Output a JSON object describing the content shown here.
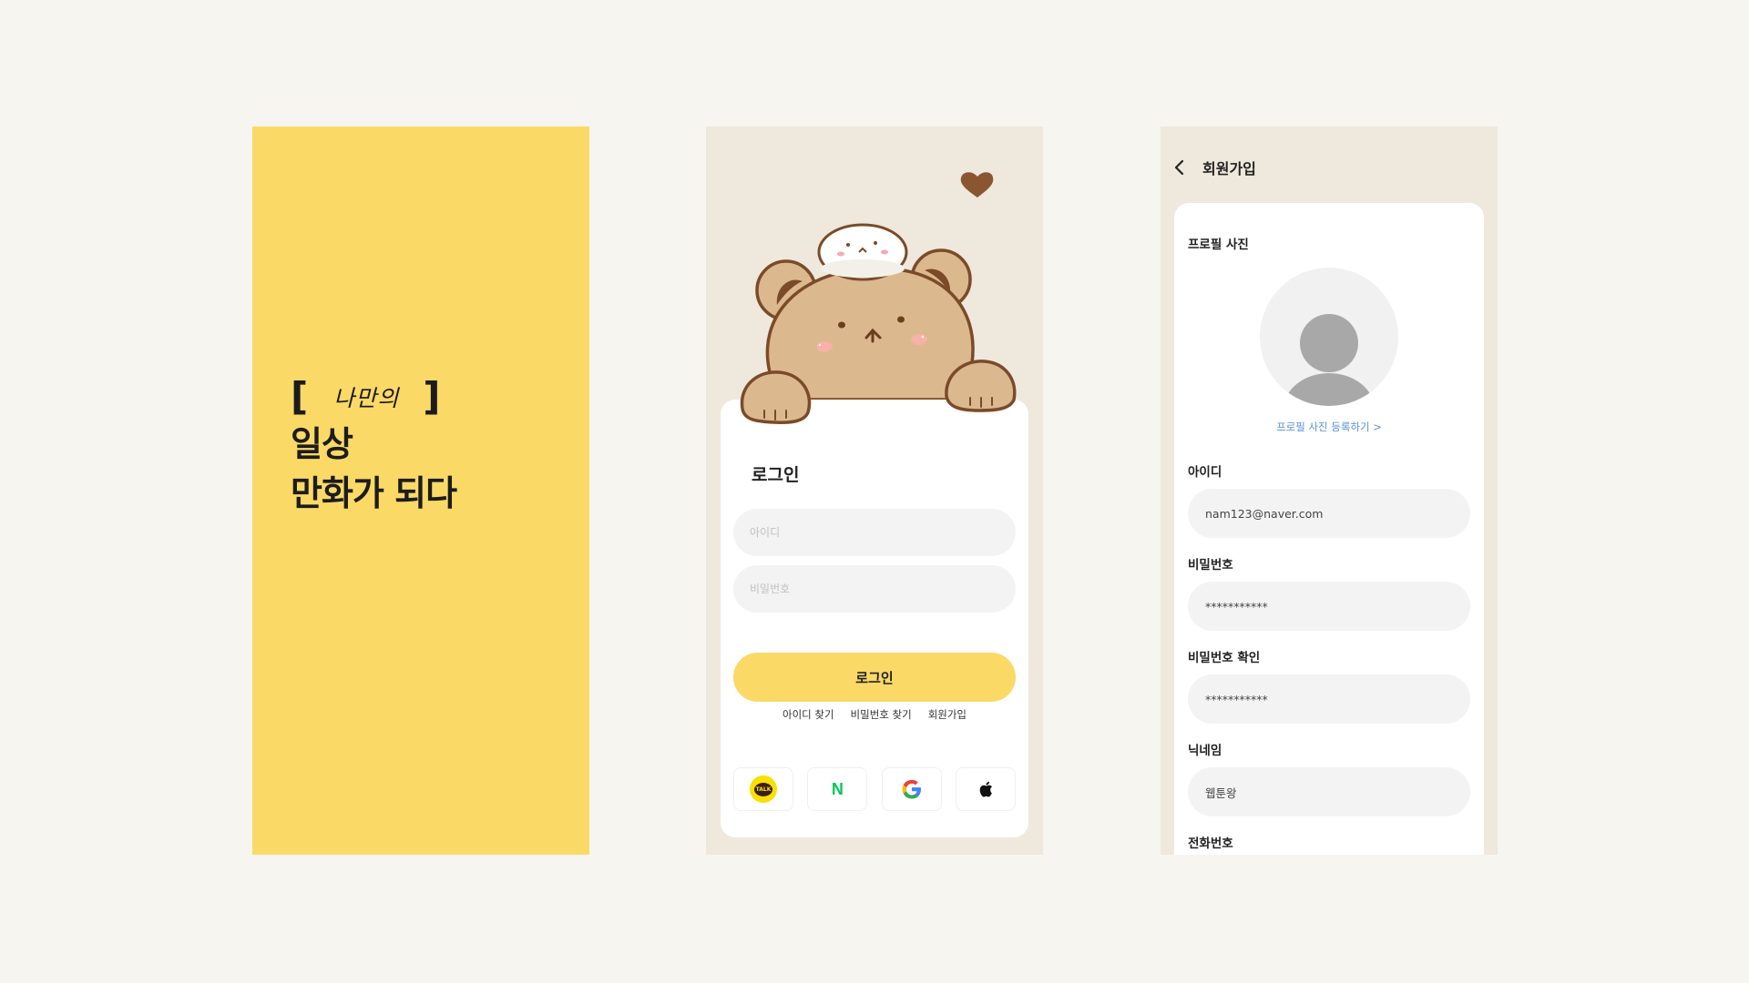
{
  "splash": {
    "bracket_open": "[",
    "script_word": "나만의",
    "bracket_close": "]",
    "line1": "일상",
    "line2": "만화가 되다"
  },
  "login": {
    "title": "로그인",
    "id_placeholder": "아이디",
    "pw_placeholder": "비밀번호",
    "login_button": "로그인",
    "links": [
      "아이디 찾기",
      "비밀번호 찾기",
      "회원가입"
    ],
    "social": [
      {
        "icon": "kakao-talk-icon",
        "text": "TALK"
      },
      {
        "icon": "naver-icon",
        "text": "N"
      },
      {
        "icon": "google-icon",
        "text": "G"
      },
      {
        "icon": "apple-icon",
        "text": ""
      }
    ]
  },
  "signup": {
    "title": "회원가입",
    "profile_label": "프로필 사진",
    "photo_link": "프로필 사진 등록하기 >",
    "id_label": "아이디",
    "id_value": "nam123@naver.com",
    "pw_label": "비밀번호",
    "pw_value": "***********",
    "pw_confirm_label": "비밀번호 확인",
    "pw_confirm_value": "***********",
    "nickname_label": "닉네임",
    "nickname_value": "웹툰왕",
    "phone_label": "전화번호"
  },
  "colors": {
    "page_bg": "#f7f5f0",
    "accent_yellow": "#fad967",
    "beige_bg": "#efe8dc",
    "bear_fill": "#dcb88f",
    "bear_outline": "#7a4b28",
    "link_blue": "#5b8fd6"
  }
}
